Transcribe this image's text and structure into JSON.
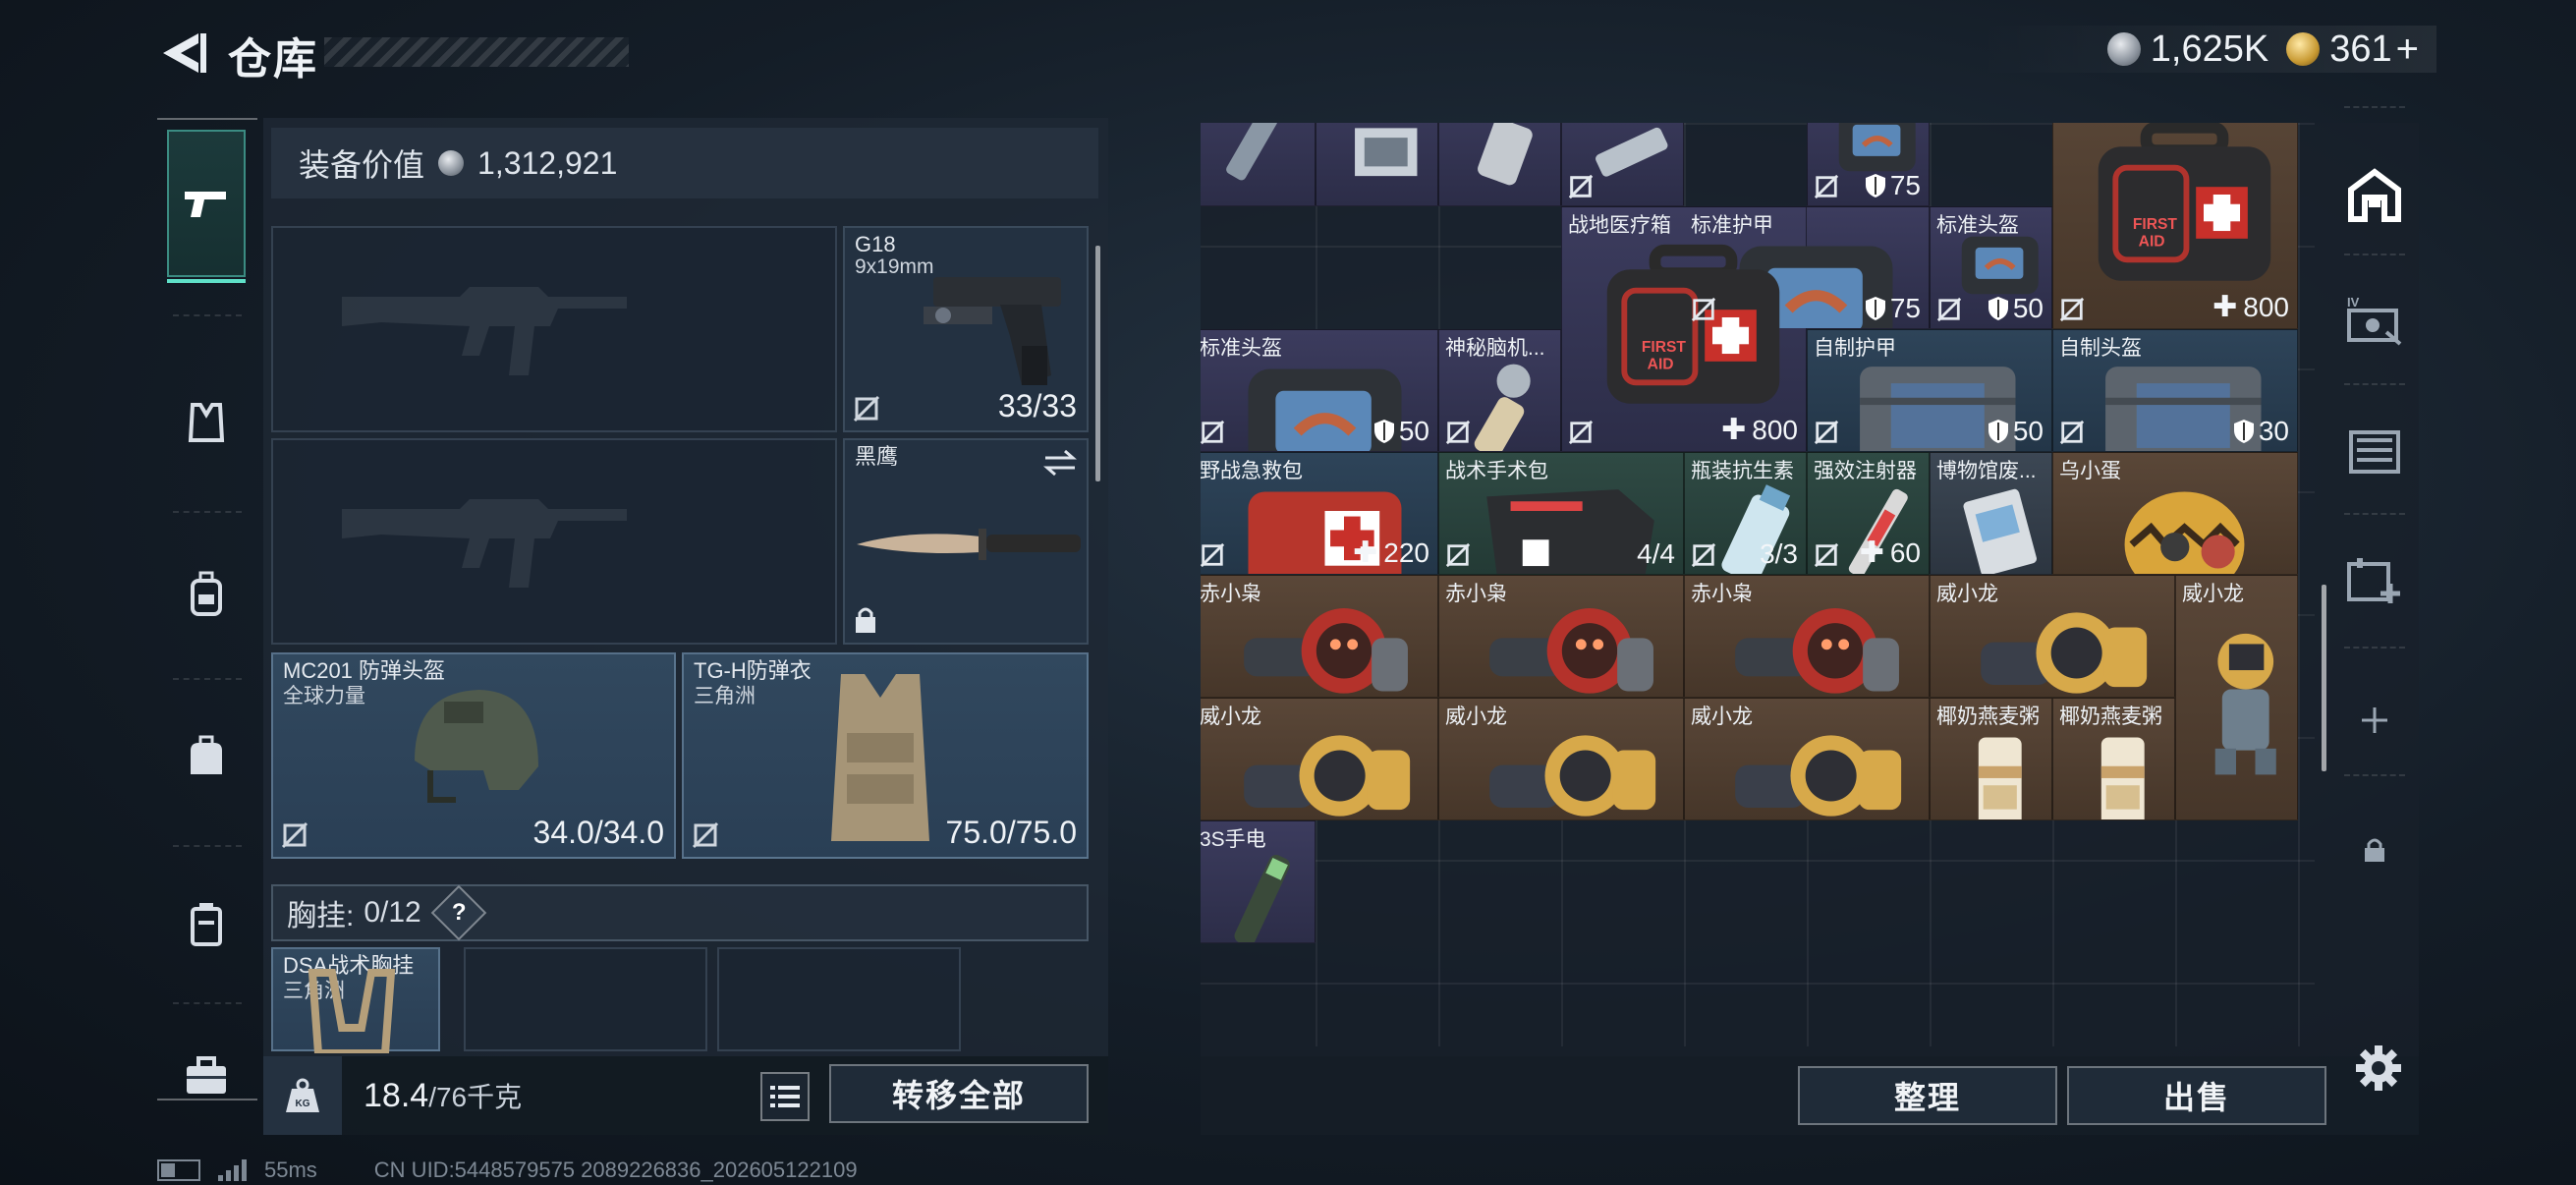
{
  "header": {
    "title": "仓库",
    "currency_silver": "1,625K",
    "currency_gold": "361",
    "currency_plus": "+"
  },
  "left_sidebar": {
    "tabs": [
      "gun-icon",
      "vest-icon",
      "backpack-icon",
      "bag-icon",
      "case-icon",
      "toolbox-icon"
    ],
    "active_tab": 0
  },
  "loadout": {
    "equip_value_label": "装备价值",
    "equip_value": "1,312,921",
    "secondary": {
      "name": "G18",
      "caliber": "9x19mm",
      "ammo": "33/33"
    },
    "melee": {
      "name": "黑鹰"
    },
    "helmet": {
      "name": "MC201 防弹头盔",
      "faction": "全球力量",
      "durability": "34.0/34.0"
    },
    "armor": {
      "name": "TG-H防弹衣",
      "faction": "三角洲",
      "durability": "75.0/75.0"
    },
    "chest_rig_label": "胸挂:",
    "chest_rig_count": "0/12",
    "chest_help": "?",
    "chest_rig": {
      "name": "DSA战术胸挂",
      "faction": "三角洲"
    },
    "weight_current": "18.4",
    "weight_max": "/76千克",
    "transfer_all": "转移全部"
  },
  "inventory": {
    "items": [
      {
        "name": "",
        "value": "",
        "color": "purple"
      },
      {
        "name": "",
        "value": "",
        "color": "purple"
      },
      {
        "name": "",
        "value": "",
        "color": "purple"
      },
      {
        "name": "",
        "value": "",
        "color": "purple"
      },
      {
        "name": "",
        "value": "75",
        "color": "purple"
      },
      {
        "name": "标准护甲",
        "value": "75",
        "color": "purple"
      },
      {
        "name": "战地医疗箱",
        "value": "800",
        "color": "purple"
      },
      {
        "name": "标准头盔",
        "value": "50",
        "color": "purple"
      },
      {
        "name": "",
        "value": "800",
        "color": "gold"
      },
      {
        "name": "标准头盔",
        "value": "50",
        "color": "purple"
      },
      {
        "name": "神秘脑机...",
        "value": "",
        "color": "purple"
      },
      {
        "name": "自制护甲",
        "value": "50",
        "color": "blue"
      },
      {
        "name": "自制头盔",
        "value": "30",
        "color": "blue"
      },
      {
        "name": "野战急救包",
        "value": "220",
        "color": "blue"
      },
      {
        "name": "战术手术包",
        "value": "4/4",
        "color": "green"
      },
      {
        "name": "瓶装抗生素",
        "value": "3/3",
        "color": "green"
      },
      {
        "name": "强效注射器",
        "value": "60",
        "color": "green"
      },
      {
        "name": "博物馆废...",
        "value": "",
        "color": "grey"
      },
      {
        "name": "乌小蛋",
        "value": "",
        "color": "gold"
      },
      {
        "name": "赤小枭",
        "value": "",
        "color": "gold"
      },
      {
        "name": "赤小枭",
        "value": "",
        "color": "gold"
      },
      {
        "name": "赤小枭",
        "value": "",
        "color": "gold"
      },
      {
        "name": "威小龙",
        "value": "",
        "color": "gold"
      },
      {
        "name": "威小龙",
        "value": "",
        "color": "gold"
      },
      {
        "name": "威小龙",
        "value": "",
        "color": "gold"
      },
      {
        "name": "威小龙",
        "value": "",
        "color": "gold"
      },
      {
        "name": "威小龙",
        "value": "",
        "color": "gold"
      },
      {
        "name": "椰奶燕麦粥",
        "value": "",
        "color": "gold"
      },
      {
        "name": "椰奶燕麦粥",
        "value": "",
        "color": "gold"
      },
      {
        "name": "3S手电",
        "value": "",
        "color": "purple"
      }
    ],
    "organize": "整理",
    "sell": "出售"
  },
  "right_sidebar": {
    "tabs": [
      "home-icon",
      "card-icon",
      "storage-icon",
      "expand-icon",
      "add-icon",
      "lock-icon"
    ]
  },
  "status": {
    "ping": "55ms",
    "uid": "CN UID:5448579575 2089226836_202605122109"
  },
  "colors": {
    "accent": "#5fe0c8",
    "purple": "#3c3c5e",
    "blue": "#2e4459",
    "gold": "#5a4738",
    "green": "#2f4a44"
  }
}
